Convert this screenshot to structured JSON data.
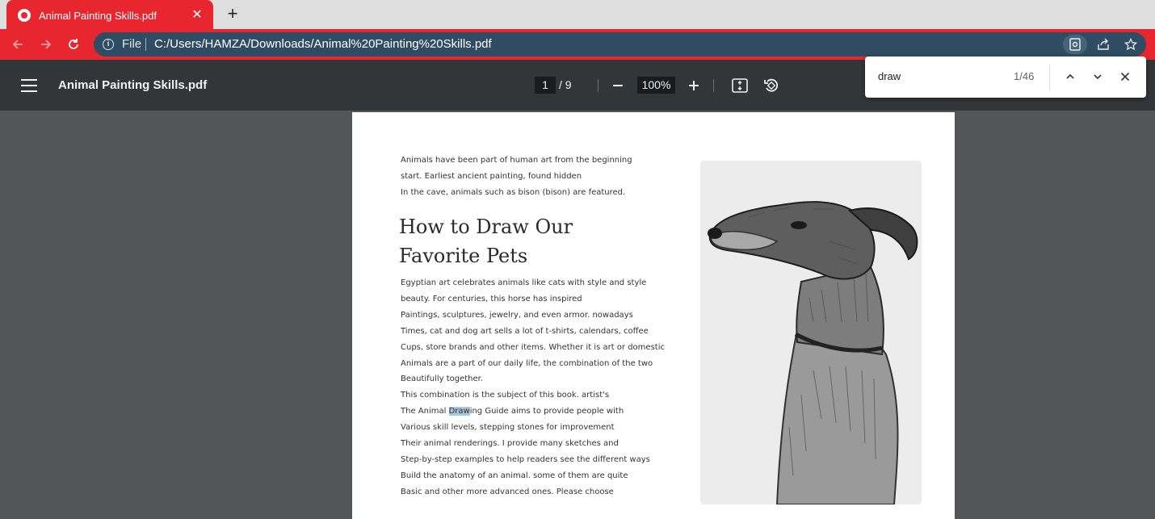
{
  "browser": {
    "tab_title": "Animal Painting Skills.pdf",
    "new_tab": "+",
    "close": "✕",
    "omnibox": {
      "scheme_label": "File",
      "url": "C:/Users/HAMZA/Downloads/Animal%20Painting%20Skills.pdf"
    }
  },
  "pdf_toolbar": {
    "title": "Animal Painting Skills.pdf",
    "current_page": "1",
    "page_total": "/  9",
    "zoom": "100%",
    "zoom_out": "—",
    "zoom_in": "+"
  },
  "find": {
    "query": "draw",
    "count": "1/46"
  },
  "document": {
    "intro_lines": [
      "Animals have been part of human art from the beginning",
      "start. Earliest ancient painting, found hidden",
      "In the cave, animals such as bison (bison) are featured."
    ],
    "heading_lines": [
      "How to Draw Our",
      "Favorite Pets"
    ],
    "body_lines": [
      "Egyptian art celebrates animals like cats with style and style",
      "beauty. For centuries, this horse has inspired",
      "Paintings, sculptures, jewelry, and even armor. nowadays",
      "Times, cat and dog art sells a lot of t-shirts, calendars, coffee",
      "Cups, store brands and other items. Whether it is art or domestic",
      "Animals are a part of our daily life, the combination of the two",
      "Beautifully together.",
      "This combination is the subject of this book. artist's",
      "The Animal ",
      "Draw",
      "ing Guide aims to provide people with",
      "Various skill levels, stepping stones for improvement",
      "Their animal renderings. I provide many sketches and",
      "Step-by-step examples to help readers see the different ways",
      "Build the anatomy of an animal. some of them are quite",
      "Basic and other more advanced ones. Please choose"
    ]
  },
  "colors": {
    "tab_red": "#e8262f",
    "omnibox_blue": "#2f4c63",
    "viewer_dark": "#323639",
    "viewer_bg": "#525659",
    "highlight": "#a7c7dd"
  }
}
